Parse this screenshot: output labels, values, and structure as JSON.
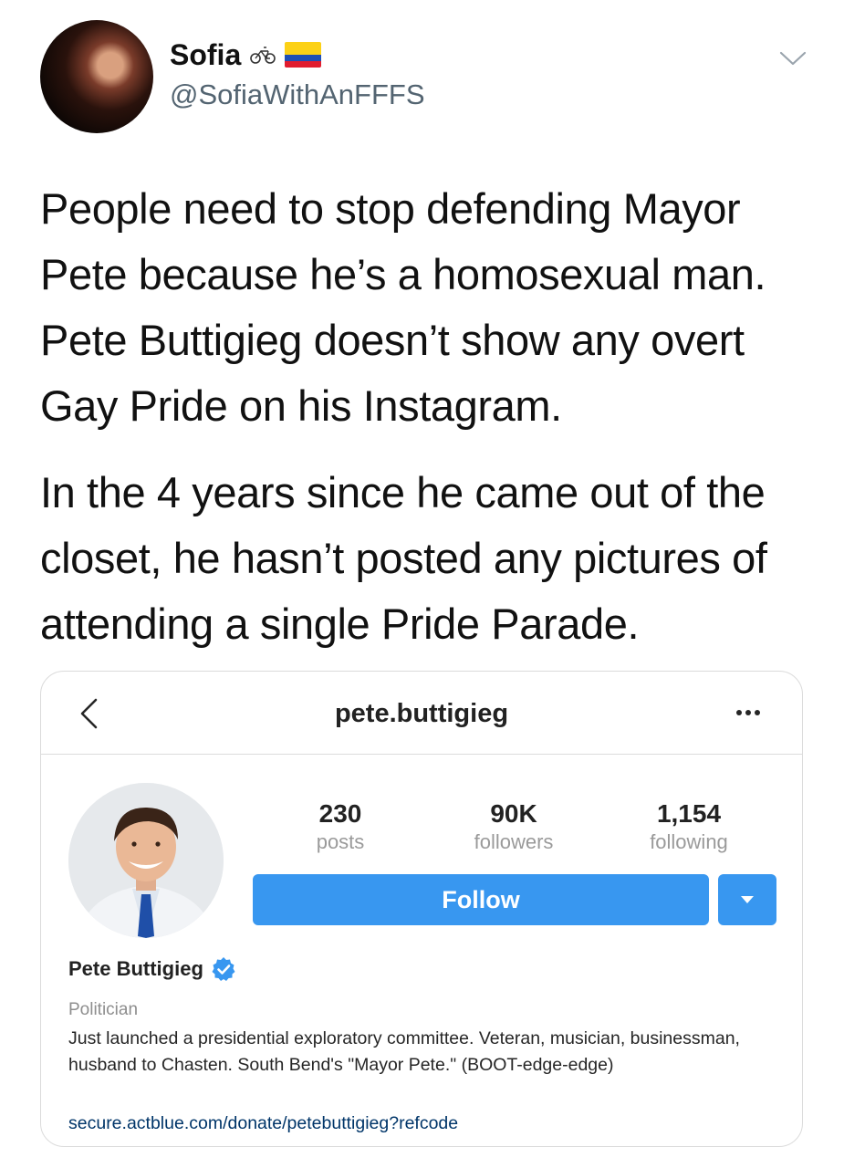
{
  "tweet": {
    "display_name": "Sofia",
    "handle": "@SofiaWithAnFFFS",
    "paragraphs": [
      "People need to stop defending Mayor Pete because he’s a homosexual man. Pete Buttigieg doesn’t show any overt Gay Pride on his Instagram.",
      "In the 4 years since he came out of the closet, he hasn’t posted any pictures of attending a single Pride Parade."
    ],
    "icons": [
      "bicycle-icon",
      "colombia-flag-icon",
      "chevron-down-icon"
    ]
  },
  "instagram": {
    "username": "pete.buttigieg",
    "stats": [
      {
        "value": "230",
        "label": "posts"
      },
      {
        "value": "90K",
        "label": "followers"
      },
      {
        "value": "1,154",
        "label": "following"
      }
    ],
    "follow_label": "Follow",
    "full_name": "Pete Buttigieg",
    "category": "Politician",
    "bio": "Just launched a presidential exploratory committee. Veteran, musician, businessman, husband to Chasten. South Bend's \"Mayor Pete.\" (BOOT-edge-edge)",
    "link": "secure.actblue.com/donate/petebuttigieg?refcode",
    "colors": {
      "accent": "#3897f0",
      "verified": "#3897f0",
      "link": "#003569"
    }
  }
}
